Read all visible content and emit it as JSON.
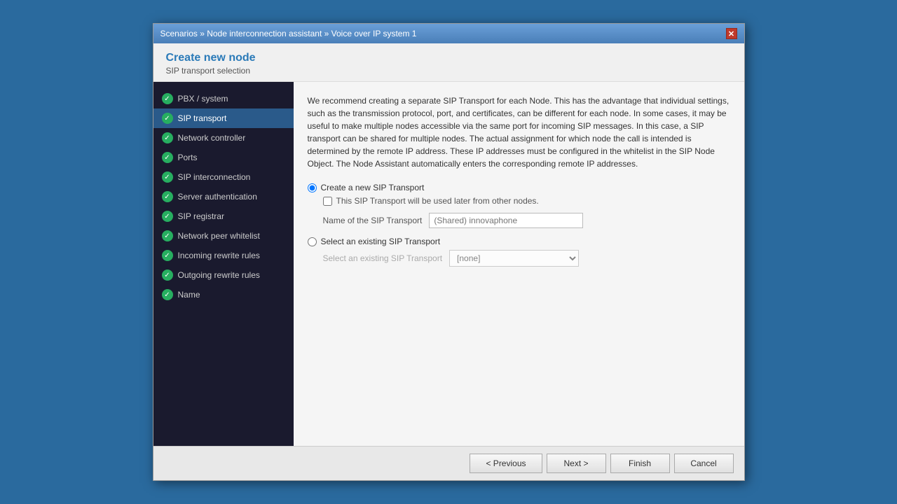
{
  "titlebar": {
    "breadcrumb": "Scenarios » Node interconnection assistant » Voice over IP system 1",
    "close_label": "✕"
  },
  "header": {
    "title": "Create new node",
    "subtitle": "SIP transport selection"
  },
  "sidebar": {
    "items": [
      {
        "id": "pbx-system",
        "label": "PBX / system",
        "completed": true,
        "active": false
      },
      {
        "id": "sip-transport",
        "label": "SIP transport",
        "completed": true,
        "active": true
      },
      {
        "id": "network-controller",
        "label": "Network controller",
        "completed": true,
        "active": false
      },
      {
        "id": "ports",
        "label": "Ports",
        "completed": true,
        "active": false
      },
      {
        "id": "sip-interconnection",
        "label": "SIP interconnection",
        "completed": true,
        "active": false
      },
      {
        "id": "server-authentication",
        "label": "Server authentication",
        "completed": true,
        "active": false
      },
      {
        "id": "sip-registrar",
        "label": "SIP registrar",
        "completed": true,
        "active": false
      },
      {
        "id": "network-peer-whitelist",
        "label": "Network peer whitelist",
        "completed": true,
        "active": false
      },
      {
        "id": "incoming-rewrite-rules",
        "label": "Incoming rewrite rules",
        "completed": true,
        "active": false
      },
      {
        "id": "outgoing-rewrite-rules",
        "label": "Outgoing rewrite rules",
        "completed": true,
        "active": false
      },
      {
        "id": "name",
        "label": "Name",
        "completed": true,
        "active": false
      }
    ]
  },
  "content": {
    "description": "We recommend creating a separate SIP Transport for each Node. This has the advantage that individual settings, such as the transmission protocol, port, and certificates, can be different for each node. In some cases, it may be useful to make multiple nodes accessible via the same port for incoming SIP messages. In this case, a SIP transport can be shared for multiple nodes. The actual assignment for which node the call is intended is determined by the remote IP address. These IP addresses must be configured in the whitelist in the SIP Node Object. The Node Assistant automatically enters the corresponding remote IP addresses.",
    "option_create_label": "Create a new SIP Transport",
    "option_create_checked": true,
    "checkbox_shared_label": "This SIP Transport will be used later from other nodes.",
    "name_field_label": "Name of the SIP Transport",
    "name_field_placeholder": "(Shared) innovaphone",
    "option_existing_label": "Select an existing SIP Transport",
    "option_existing_checked": false,
    "existing_select_label": "Select an existing SIP Transport",
    "existing_select_options": [
      "[none]"
    ],
    "existing_select_value": "[none]"
  },
  "footer": {
    "previous_label": "< Previous",
    "next_label": "Next >",
    "finish_label": "Finish",
    "cancel_label": "Cancel"
  }
}
